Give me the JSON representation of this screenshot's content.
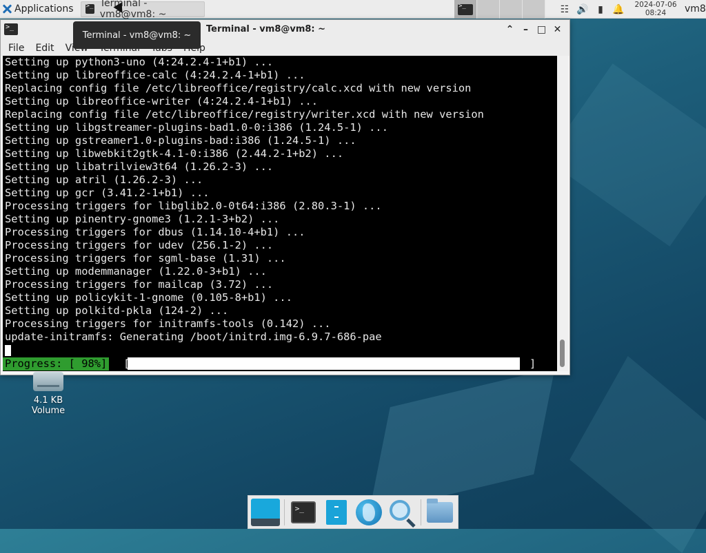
{
  "top_panel": {
    "applications_label": "Applications",
    "task_title": "Terminal - vm8@vm8: ~",
    "clock_date": "2024-07-06",
    "clock_time": "08:24",
    "user": "vm8"
  },
  "tooltip": {
    "text": "Terminal - vm8@vm8: ~"
  },
  "window": {
    "title": "Terminal - vm8@vm8: ~",
    "menu": [
      "File",
      "Edit",
      "View",
      "Terminal",
      "Tabs",
      "Help"
    ]
  },
  "terminal": {
    "lines": [
      "Setting up python3-uno (4:24.2.4-1+b1) ...",
      "Setting up libreoffice-calc (4:24.2.4-1+b1) ...",
      "Replacing config file /etc/libreoffice/registry/calc.xcd with new version",
      "Setting up libreoffice-writer (4:24.2.4-1+b1) ...",
      "Replacing config file /etc/libreoffice/registry/writer.xcd with new version",
      "Setting up libgstreamer-plugins-bad1.0-0:i386 (1.24.5-1) ...",
      "Setting up gstreamer1.0-plugins-bad:i386 (1.24.5-1) ...",
      "Setting up libwebkit2gtk-4.1-0:i386 (2.44.2-1+b2) ...",
      "Setting up libatrilview3t64 (1.26.2-3) ...",
      "Setting up atril (1.26.2-3) ...",
      "Setting up gcr (3.41.2-1+b1) ...",
      "Processing triggers for libglib2.0-0t64:i386 (2.80.3-1) ...",
      "Setting up pinentry-gnome3 (1.2.1-3+b2) ...",
      "Processing triggers for dbus (1.14.10-4+b1) ...",
      "Processing triggers for udev (256.1-2) ...",
      "Processing triggers for sgml-base (1.31) ...",
      "Setting up modemmanager (1.22.0-3+b1) ...",
      "Processing triggers for mailcap (3.72) ...",
      "Setting up policykit-1-gnome (0.105-8+b1) ...",
      "Setting up polkitd-pkla (124-2) ...",
      "Processing triggers for initramfs-tools (0.142) ...",
      "update-initramfs: Generating /boot/initrd.img-6.9.7-686-pae"
    ],
    "progress_label": "Progress: [ 98%]",
    "progress_value": 0.98,
    "bracket_open": "[",
    "bracket_close": "]"
  },
  "desktop": {
    "volume_line1": "4.1 KB",
    "volume_line2": "Volume"
  },
  "dock": {
    "items": [
      "show-desktop-icon",
      "terminal-icon",
      "file-cabinet-icon",
      "web-browser-globe-icon",
      "app-finder-search-icon",
      "home-folder-icon"
    ]
  },
  "colors": {
    "progress_green": "#2f9c2f",
    "terminal_bg": "#000000",
    "desktop_blue": "#1d5e7a"
  }
}
